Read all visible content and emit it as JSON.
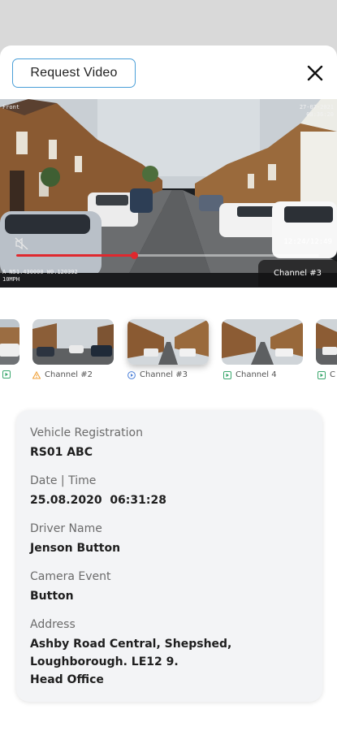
{
  "header": {
    "request_video_label": "Request Video",
    "close_icon": "close-icon"
  },
  "video": {
    "osd_top_left": "Front",
    "osd_top_right_date": "27-07-2021",
    "osd_top_right_time": "08:36:20",
    "osd_bottom_left_line1": "A N51.430000 W0.120392",
    "osd_bottom_left_line2": "10MPH",
    "time_display": "12:24/12:49",
    "progress": 0.39,
    "channel_badge": "Channel #3",
    "mute_icon": "muted-speaker-icon"
  },
  "channels": [
    {
      "label": "",
      "icon": "play-icon",
      "icon_color": "#3aa76d"
    },
    {
      "label": "Channel #2",
      "icon": "warning-icon",
      "icon_color": "#f0a23b"
    },
    {
      "label": "Channel #3",
      "icon": "play-circle-icon",
      "icon_color": "#4a7fd8",
      "active": true
    },
    {
      "label": "Channel 4",
      "icon": "play-icon",
      "icon_color": "#3aa76d"
    },
    {
      "label": "C",
      "icon": "play-icon",
      "icon_color": "#3aa76d"
    }
  ],
  "details": {
    "vehicle_registration": {
      "label": "Vehicle Registration",
      "value": "RS01 ABC"
    },
    "date_time": {
      "label": "Date | Time",
      "value": "25.08.2020  06:31:28"
    },
    "driver_name": {
      "label": "Driver Name",
      "value": "Jenson Button"
    },
    "camera_event": {
      "label": "Camera Event",
      "value": "Button"
    },
    "address": {
      "label": "Address",
      "line1": "Ashby Road Central, Shepshed,",
      "line2": "Loughborough. LE12 9.",
      "line3": "Head Office"
    }
  },
  "colors": {
    "accent_blue": "#4a9fd8",
    "progress_red": "#e0282e",
    "card_bg": "#f3f4f6"
  }
}
